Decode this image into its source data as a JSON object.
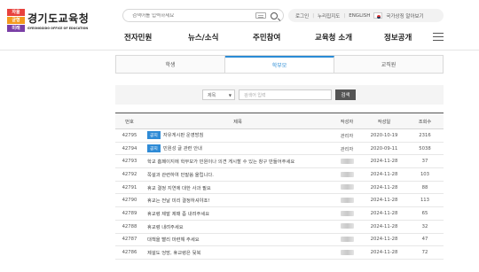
{
  "logo": {
    "mark": [
      "자율",
      "균형",
      "미래"
    ],
    "title": "경기도교육청",
    "subtitle": "GYEONGGIDO OFFICE OF EDUCATION"
  },
  "search": {
    "placeholder": "검색어를 입력하세요"
  },
  "util": {
    "login": "로그인",
    "sitemap": "누리집지도",
    "english": "ENGLISH",
    "nation": "국가상징 알아보기"
  },
  "gnb": [
    "전자민원",
    "뉴스/소식",
    "주민참여",
    "교육청 소개",
    "정보공개"
  ],
  "tabs": [
    {
      "label": "학생",
      "active": false
    },
    {
      "label": "학부모",
      "active": true
    },
    {
      "label": "교직원",
      "active": false
    }
  ],
  "filter": {
    "select_value": "제목",
    "keyword_placeholder": "검색어 입력",
    "button": "검색"
  },
  "table": {
    "headers": [
      "번호",
      "제목",
      "작성자",
      "작성일",
      "조회수"
    ],
    "rows": [
      {
        "no": "42795",
        "badge": "공지",
        "title": "자유게시판 운영방침",
        "author": "관리자",
        "date": "2020-10-19",
        "views": "2316"
      },
      {
        "no": "42794",
        "badge": "공지",
        "title": "민원성 글 관련 안내",
        "author": "관리자",
        "date": "2020-09-11",
        "views": "5038"
      },
      {
        "no": "42793",
        "badge": "",
        "title": "학교 홈페이지에 학부모가 민원이나 의견 게시할 수 있는 창구 만들어주세요",
        "author": "",
        "date": "2024-11-28",
        "views": "37"
      },
      {
        "no": "42792",
        "badge": "",
        "title": "쪽설과 관련하여 민말씀 올립니다.",
        "author": "",
        "date": "2024-11-28",
        "views": "103"
      },
      {
        "no": "42791",
        "badge": "",
        "title": "휴교 결정 지연에 대한 사과 필요",
        "author": "",
        "date": "2024-11-28",
        "views": "88"
      },
      {
        "no": "42790",
        "badge": "",
        "title": "휴교는 전날 미리 결정하셔야죠!",
        "author": "",
        "date": "2024-11-28",
        "views": "113"
      },
      {
        "no": "42789",
        "badge": "",
        "title": "휴교령 제발 제때 좀 내려주세요",
        "author": "",
        "date": "2024-11-28",
        "views": "65"
      },
      {
        "no": "42788",
        "badge": "",
        "title": "휴교령 내려주세요",
        "author": "",
        "date": "2024-11-28",
        "views": "32"
      },
      {
        "no": "42787",
        "badge": "",
        "title": "대책을 빨리 마련해 주세요",
        "author": "",
        "date": "2024-11-28",
        "views": "47"
      },
      {
        "no": "42786",
        "badge": "",
        "title": "제설도 엉망, 휴교령은 뒷북",
        "author": "",
        "date": "2024-11-28",
        "views": "72"
      }
    ]
  }
}
